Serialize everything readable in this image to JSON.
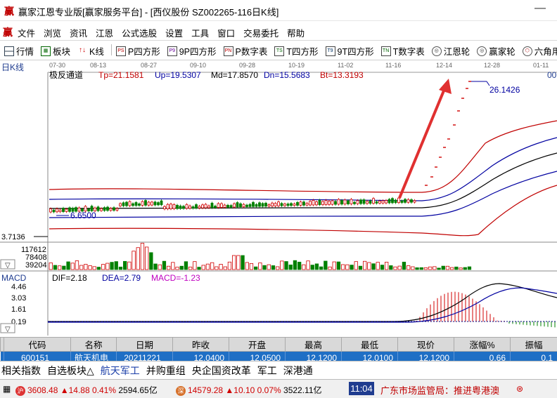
{
  "window": {
    "logo": "赢",
    "title": "赢家江恩专业版[赢家服务平台] - [西仪股份   SZ002265-116日K线]",
    "minimize_glyph": "—"
  },
  "menu": {
    "logo": "赢",
    "items": [
      "文件",
      "浏览",
      "资讯",
      "江恩",
      "公式选股",
      "设置",
      "工具",
      "窗口",
      "交易委托",
      "帮助"
    ]
  },
  "toolbar": {
    "items": [
      {
        "label": "行情",
        "icon": "grid-icon",
        "glyph": ""
      },
      {
        "label": "板块",
        "icon": "blocks-icon",
        "glyph": "▦"
      },
      {
        "label": "K线",
        "icon": "candle-icon",
        "glyph": "↑↓"
      },
      {
        "label": "P四方形",
        "icon": "p-square-icon",
        "glyph": "PS"
      },
      {
        "label": "9P四方形",
        "icon": "9p-square-icon",
        "glyph": "P9"
      },
      {
        "label": "P数字表",
        "icon": "p-number-icon",
        "glyph": "PN"
      },
      {
        "label": "T四方形",
        "icon": "t-square-icon",
        "glyph": "TS"
      },
      {
        "label": "9T四方形",
        "icon": "9t-square-icon",
        "glyph": "T9"
      },
      {
        "label": "T数字表",
        "icon": "t-number-icon",
        "glyph": "TN"
      },
      {
        "label": "江恩轮",
        "icon": "gann-wheel-icon",
        "glyph": "◎"
      },
      {
        "label": "赢家轮",
        "icon": "winner-wheel-icon",
        "glyph": "◎"
      },
      {
        "label": "六角用",
        "icon": "hexagon-icon",
        "glyph": "⬡"
      }
    ]
  },
  "kline": {
    "period_label": "日K线",
    "indicator_name": "极反通道",
    "dates": [
      "07-30",
      "08-13",
      "08-27",
      "09-10",
      "09-28",
      "10-19",
      "11-02",
      "11-16",
      "12-14",
      "12-28",
      "01-11"
    ],
    "tp": "Tp=21.1581",
    "up": "Up=19.5307",
    "md": "Md=17.8570",
    "dn": "Dn=15.5683",
    "bt": "Bt=13.3193",
    "high_label": "26.1426",
    "low_label": "6.6500",
    "price_axis_low": "3.7136",
    "right_edge": "00",
    "volume_axis": [
      "117612",
      "78408",
      "39204"
    ]
  },
  "macd": {
    "name": "MACD",
    "dif": "DIF=2.18",
    "dea": "DEA=2.79",
    "macd": "MACD=-1.23",
    "axis": [
      "4.46",
      "3.03",
      "1.61",
      "0.19"
    ]
  },
  "quote_table": {
    "headers": [
      "代码",
      "名称",
      "日期",
      "昨收",
      "开盘",
      "最高",
      "最低",
      "现价",
      "涨幅%",
      "振幅"
    ],
    "row": [
      "600151",
      "航天机电",
      "20211221",
      "12.0400",
      "12.0500",
      "12.1200",
      "12.0100",
      "12.1200",
      "0.66",
      "0.1"
    ]
  },
  "tabs": [
    "相关指数",
    "自选板块△",
    "航天军工",
    "并购重组",
    "央企国资改革",
    "军工",
    "深港通"
  ],
  "active_tab": "航天军工",
  "status": {
    "sh_badge": "沪",
    "sh_index": "3608.48",
    "sh_change": "▲14.88 0.41%",
    "sh_amount": "2594.65亿",
    "sz_badge": "深",
    "sz_index": "14579.28",
    "sz_change": "▲10.10 0.07%",
    "sz_amount": "3522.11亿",
    "clock": "11:04",
    "news": "广东市场监管局：推进粤港澳"
  },
  "colors": {
    "up": "#d00000",
    "down": "#008000",
    "band_outer": "#c00000",
    "band_mid": "#0000a0",
    "arrow": "#e03030",
    "row_bg": "#1f6fc5"
  }
}
